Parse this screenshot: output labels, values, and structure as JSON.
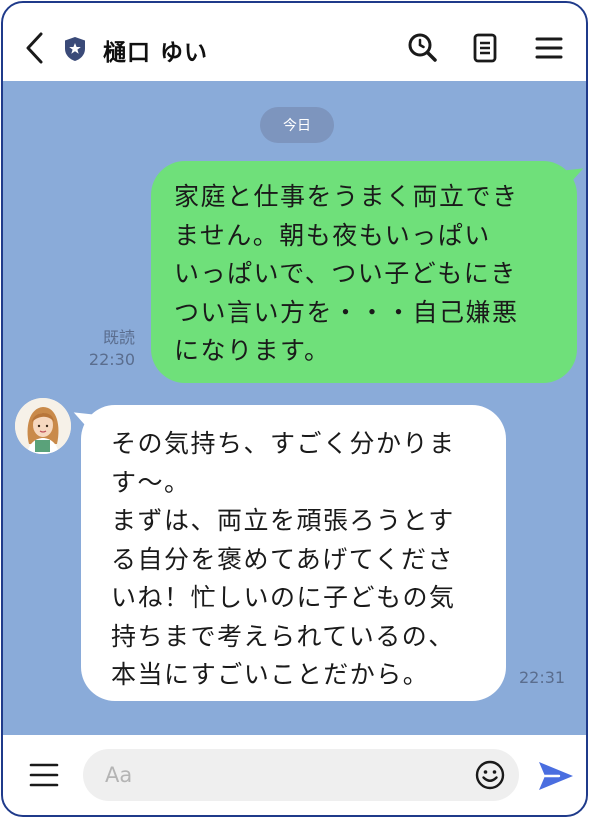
{
  "header": {
    "title": "樋口 ゆい",
    "icons": [
      "back-icon",
      "shield-star-icon",
      "search-icon",
      "notes-icon",
      "menu-icon"
    ]
  },
  "chat": {
    "date_label": "今日",
    "messages": [
      {
        "sender": "me",
        "text": "家庭と仕事をうまく両立でき\nません。朝も夜もいっぱい\nいっぱいで、つい子どもにき\nつい言い方を・・・自己嫌悪\nになります。",
        "read_label": "既読",
        "time": "22:30"
      },
      {
        "sender": "other",
        "text": "その気持ち、すごく分かりま\nす〜。\nまずは、両立を頑張ろうとす\nる自分を褒めてあげてくださ\nいね！忙しいのに子どもの気\n持ちまで考えられているの、\n本当にすごいことだから。",
        "time": "22:31"
      }
    ]
  },
  "footer": {
    "input_placeholder": "Aa",
    "input_value": ""
  },
  "colors": {
    "chat_background": "#8aabd9",
    "my_bubble": "#6fe07a",
    "other_bubble": "#ffffff",
    "send_icon": "#4a6ee0",
    "frame": "#1f3a8a"
  }
}
